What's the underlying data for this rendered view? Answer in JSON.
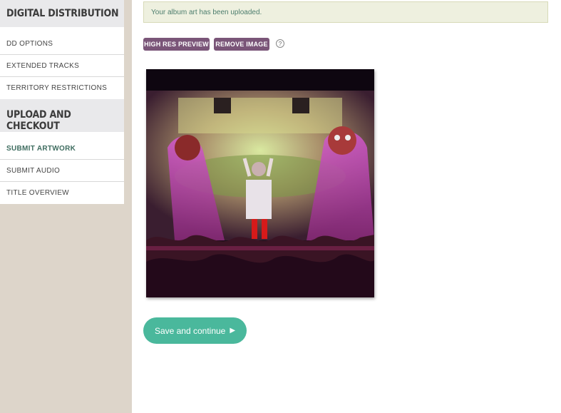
{
  "sidebar": {
    "sections": [
      {
        "heading": "DIGITAL DISTRIBUTION",
        "items": [
          {
            "label": "DD OPTIONS"
          },
          {
            "label": "EXTENDED TRACKS"
          },
          {
            "label": "TERRITORY RESTRICTIONS"
          }
        ]
      },
      {
        "heading": "UPLOAD AND CHECKOUT",
        "items": [
          {
            "label": "SUBMIT ARTWORK",
            "active": true
          },
          {
            "label": "SUBMIT AUDIO"
          },
          {
            "label": "TITLE OVERVIEW"
          }
        ]
      }
    ]
  },
  "main": {
    "alert_text": "Your album art has been uploaded.",
    "buttons": {
      "high_res_preview": "HIGH RES PREVIEW",
      "remove_image": "REMOVE IMAGE"
    },
    "help_icon_glyph": "?",
    "save_label": "Save and continue",
    "save_glyph": "▶"
  },
  "colors": {
    "accent_green": "#4ab89c",
    "button_purple": "#7a5578",
    "active_nav": "#3f6d60"
  }
}
